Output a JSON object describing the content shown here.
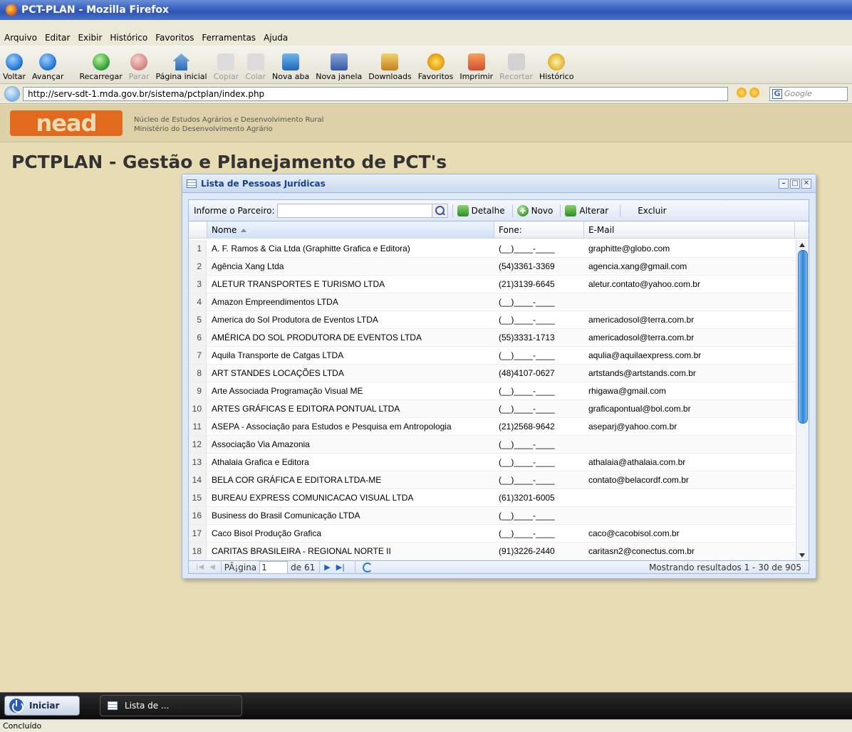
{
  "browser": {
    "title": "PCT-PLAN - Mozilla Firefox",
    "menu": [
      "Arquivo",
      "Editar",
      "Exibir",
      "Histórico",
      "Favoritos",
      "Ferramentas",
      "Ajuda"
    ],
    "toolbar": [
      {
        "label": "Voltar",
        "icon": "back-icon"
      },
      {
        "label": "Avançar",
        "icon": "forward-icon"
      },
      {
        "label": "Recarregar",
        "icon": "reload-icon"
      },
      {
        "label": "Parar",
        "icon": "stop-icon"
      },
      {
        "label": "Página inicial",
        "icon": "home-icon"
      },
      {
        "label": "Copiar",
        "icon": "copy-icon"
      },
      {
        "label": "Colar",
        "icon": "paste-icon"
      },
      {
        "label": "Nova aba",
        "icon": "new-tab-icon"
      },
      {
        "label": "Nova janela",
        "icon": "new-window-icon"
      },
      {
        "label": "Downloads",
        "icon": "downloads-icon"
      },
      {
        "label": "Favoritos",
        "icon": "bookmarks-icon"
      },
      {
        "label": "Imprimir",
        "icon": "print-icon"
      },
      {
        "label": "Recortar",
        "icon": "cut-icon"
      },
      {
        "label": "Histórico",
        "icon": "history-icon"
      }
    ],
    "address": "http://serv-sdt-1.mda.gov.br/sistema/pctplan/index.php",
    "search_placeholder": "Google",
    "status": "Concluído"
  },
  "site": {
    "logo_text": "nead",
    "org_line1": "Núcleo de Estudos Agrários e Desenvolvimento Rural",
    "org_line2": "Ministério do Desenvolvimento Agrário",
    "page_title": "PCTPLAN - Gestão e Planejamento de PCT's"
  },
  "window": {
    "title": "Lista de Pessoas Jurídicas",
    "toolbar": {
      "search_label": "Informe o Parceiro:",
      "detail": "Detalhe",
      "new": "Novo",
      "edit": "Alterar",
      "delete": "Excluir"
    },
    "columns": {
      "name": "Nome",
      "phone": "Fone:",
      "email": "E-Mail"
    },
    "rows": [
      {
        "n": "1",
        "nome": "A. F. Ramos & Cia Ltda (Graphitte Grafica e Editora)",
        "fone": "(__)____-____",
        "email": "graphitte@globo.com"
      },
      {
        "n": "2",
        "nome": "Agência Xang Ltda",
        "fone": "(54)3361-3369",
        "email": "agencia.xang@gmail.com"
      },
      {
        "n": "3",
        "nome": "ALETUR TRANSPORTES E TURISMO LTDA",
        "fone": "(21)3139-6645",
        "email": "aletur.contato@yahoo.com.br"
      },
      {
        "n": "4",
        "nome": "Amazon Empreendimentos LTDA",
        "fone": "(__)____-____",
        "email": ""
      },
      {
        "n": "5",
        "nome": "America do Sol Produtora de Eventos LTDA",
        "fone": "(__)____-____",
        "email": "americadosol@terra.com.br"
      },
      {
        "n": "6",
        "nome": "AMÉRICA DO SOL PRODUTORA DE EVENTOS LTDA",
        "fone": "(55)3331-1713",
        "email": "americadosol@terra.com.br"
      },
      {
        "n": "7",
        "nome": "Aquila Transporte de Catgas LTDA",
        "fone": "(__)____-____",
        "email": "aqulia@aquilaexpress.com.br"
      },
      {
        "n": "8",
        "nome": "ART STANDES LOCAÇÕES LTDA",
        "fone": "(48)4107-0627",
        "email": "artstands@artstands.com.br"
      },
      {
        "n": "9",
        "nome": "Arte Associada Programação Visual ME",
        "fone": "(__)____-____",
        "email": "rhigawa@gmail.com"
      },
      {
        "n": "10",
        "nome": "ARTES GRÁFICAS E EDITORA PONTUAL LTDA",
        "fone": "(__)____-____",
        "email": "graficapontual@bol.com.br"
      },
      {
        "n": "11",
        "nome": "ASEPA - Associação para Estudos e Pesquisa em Antropologia",
        "fone": "(21)2568-9642",
        "email": "aseparj@yahoo.com.br"
      },
      {
        "n": "12",
        "nome": "Associação Via Amazonia",
        "fone": "(__)____-____",
        "email": ""
      },
      {
        "n": "13",
        "nome": "Athalaia Grafica e Editora",
        "fone": "(__)____-____",
        "email": "athalaia@athalaia.com.br"
      },
      {
        "n": "14",
        "nome": "BELA COR GRÁFICA E EDITORA LTDA-ME",
        "fone": "(__)____-____",
        "email": "contato@belacordf.com.br"
      },
      {
        "n": "15",
        "nome": "BUREAU EXPRESS COMUNICACAO VISUAL LTDA",
        "fone": "(61)3201-6005",
        "email": ""
      },
      {
        "n": "16",
        "nome": "Business do Brasil Comunicação LTDA",
        "fone": "(__)____-____",
        "email": ""
      },
      {
        "n": "17",
        "nome": "Caco Bisol Produção Grafica",
        "fone": "(__)____-____",
        "email": "caco@cacobisol.com.br"
      },
      {
        "n": "18",
        "nome": "CARITAS BRASILEIRA - REGIONAL NORTE II",
        "fone": "(91)3226-2440",
        "email": "caritasn2@conectus.com.br"
      }
    ],
    "paging": {
      "page_label": "PÃ¡gina",
      "page_value": "1",
      "of_label": "de 61",
      "info": "Mostrando resultados 1 - 30 de 905"
    }
  },
  "taskbar": {
    "start": "Iniciar",
    "task": "Lista de ..."
  }
}
